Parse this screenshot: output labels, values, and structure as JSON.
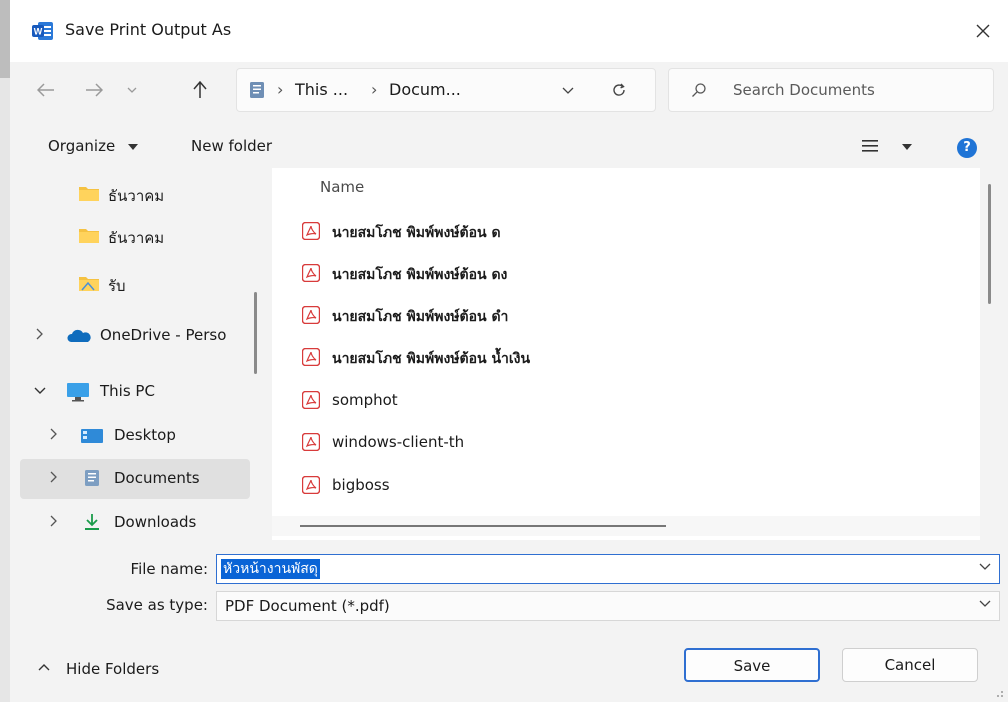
{
  "window": {
    "title": "Save Print Output As",
    "app_icon": "word-icon"
  },
  "address_bar": {
    "crumbs": [
      "This ...",
      "Docum..."
    ]
  },
  "search": {
    "placeholder": "Search Documents"
  },
  "command_bar": {
    "organize_label": "Organize",
    "new_folder_label": "New folder",
    "help_label": "?"
  },
  "sidebar": {
    "items": [
      {
        "label": "ธันวาคม",
        "icon": "folder-icon"
      },
      {
        "label": "ธันวาคม",
        "icon": "folder-icon"
      },
      {
        "label": "รับ",
        "icon": "folder-icon"
      },
      {
        "label": "OneDrive - Perso",
        "icon": "onedrive-icon"
      },
      {
        "label": "This PC",
        "icon": "computer-icon"
      },
      {
        "label": "Desktop",
        "icon": "desktop-icon"
      },
      {
        "label": "Documents",
        "icon": "documents-icon",
        "selected": true
      },
      {
        "label": "Downloads",
        "icon": "download-icon"
      }
    ]
  },
  "file_list": {
    "column_name": "Name",
    "files": [
      {
        "name": "นายสมโภช พิมพ์พงษ์ต้อน ด",
        "icon": "pdf-icon"
      },
      {
        "name": "นายสมโภช พิมพ์พงษ์ต้อน ดง",
        "icon": "pdf-icon"
      },
      {
        "name": "นายสมโภช พิมพ์พงษ์ต้อน ดำ",
        "icon": "pdf-icon"
      },
      {
        "name": "นายสมโภช พิมพ์พงษ์ต้อน น้ำเงิน",
        "icon": "pdf-icon"
      },
      {
        "name": "somphot",
        "icon": "pdf-icon"
      },
      {
        "name": "windows-client-th",
        "icon": "pdf-icon"
      },
      {
        "name": "bigboss",
        "icon": "pdf-icon"
      }
    ]
  },
  "form": {
    "file_name_label": "File name:",
    "file_name_value": "หัวหน้างานพัสดุ",
    "save_type_label": "Save as type:",
    "save_type_value": "PDF Document (*.pdf)"
  },
  "footer": {
    "hide_folders_label": "Hide Folders",
    "save_label": "Save",
    "cancel_label": "Cancel"
  },
  "colors": {
    "accent": "#2f6fd1",
    "pdf_red": "#d83b3b",
    "folder_yellow": "#f5c242"
  }
}
